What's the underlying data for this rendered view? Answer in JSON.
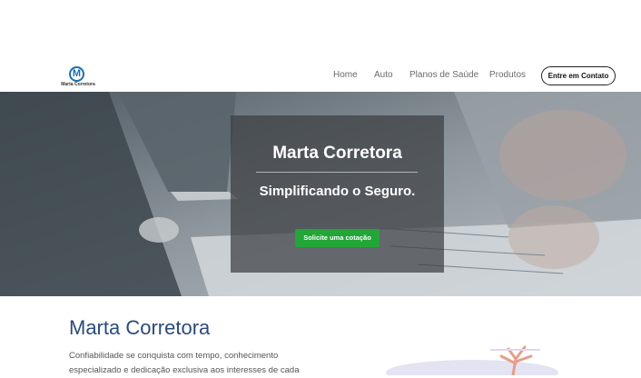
{
  "header": {
    "logo_text": "Marta Corretora",
    "logo_letter": "M",
    "nav": [
      {
        "label": "Home"
      },
      {
        "label": "Auto"
      },
      {
        "label": "Planos de Saúde"
      },
      {
        "label": "Produtos"
      }
    ],
    "contact_button": "Entre em Contato"
  },
  "hero": {
    "title": "Marta Corretora",
    "subtitle": "Simplificando o Seguro.",
    "cta": "Solicite uma cotação"
  },
  "about": {
    "title": "Marta Corretora",
    "text_line1": "Confiabilidade se conquista com tempo, conhecimento",
    "text_line2": "especializado e dedicação exclusiva aos interesses de cada"
  },
  "colors": {
    "accent_green": "#21a637",
    "title_blue": "#2c4b7a"
  }
}
